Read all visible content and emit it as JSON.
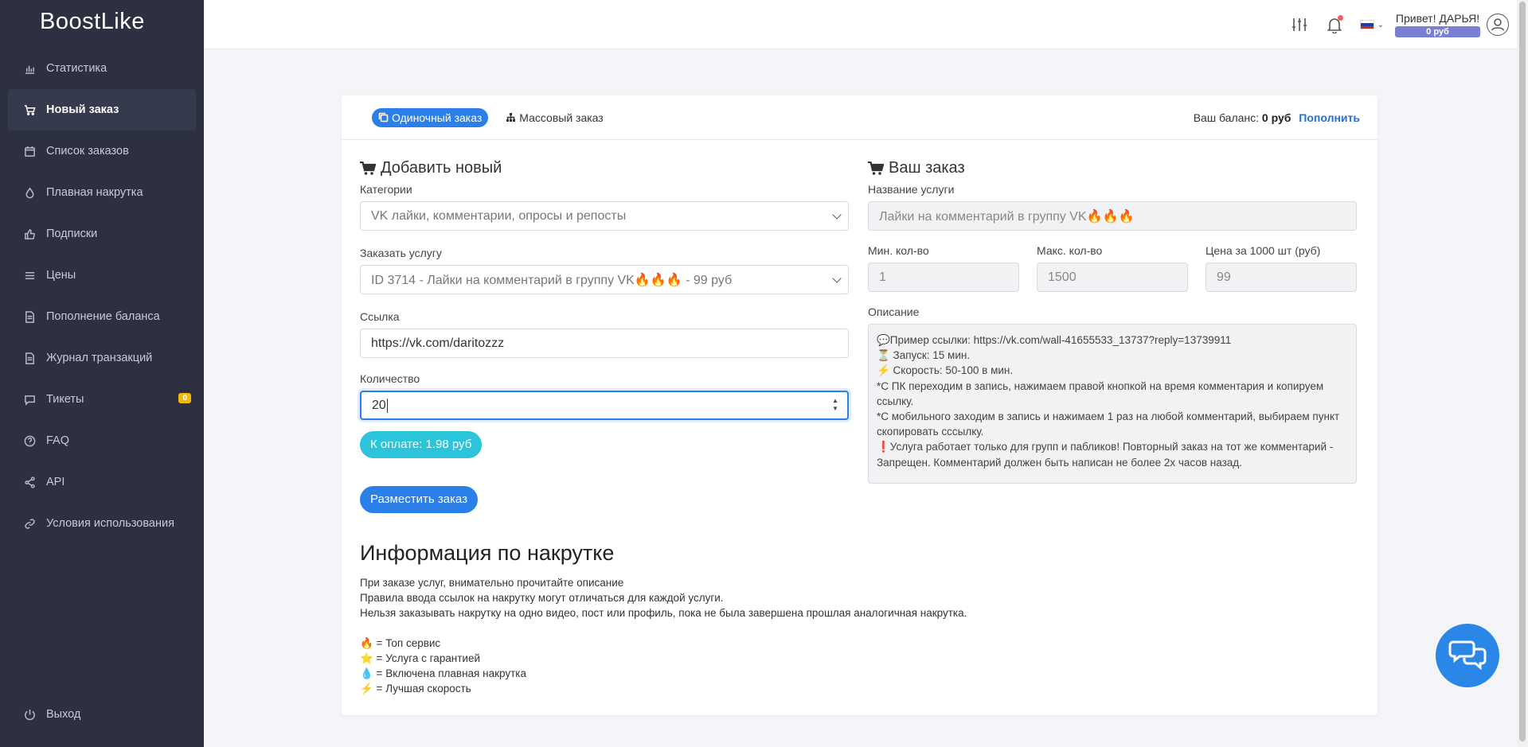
{
  "app": {
    "logo_text": "BoostLike"
  },
  "sidebar": {
    "items": [
      {
        "label": "Статистика",
        "icon": "bar-chart-icon"
      },
      {
        "label": "Новый заказ",
        "icon": "cart-icon",
        "active": true
      },
      {
        "label": "Список заказов",
        "icon": "calendar-icon"
      },
      {
        "label": "Плавная накрутка",
        "icon": "drop-icon"
      },
      {
        "label": "Подписки",
        "icon": "thumbs-up-icon"
      },
      {
        "label": "Цены",
        "icon": "list-icon"
      },
      {
        "label": "Пополнение баланса",
        "icon": "document-icon"
      },
      {
        "label": "Журнал транзакций",
        "icon": "document-icon"
      },
      {
        "label": "Тикеты",
        "icon": "chat-icon",
        "badge": "0"
      },
      {
        "label": "FAQ",
        "icon": "question-icon"
      },
      {
        "label": "API",
        "icon": "share-icon"
      },
      {
        "label": "Условия использования",
        "icon": "link-icon"
      }
    ],
    "logout_label": "Выход"
  },
  "topbar": {
    "greeting": "Привет! ДАРЬЯ!",
    "balance_badge": "0 руб"
  },
  "card": {
    "tabs": [
      {
        "label": "Одиночный заказ",
        "active": true
      },
      {
        "label": "Массовый заказ",
        "active": false
      }
    ],
    "balance_label": "Ваш баланс:",
    "balance_value": "0 руб",
    "topup_label": "Пополнить"
  },
  "form": {
    "title": "Добавить новый",
    "category_label": "Категории",
    "category_value": "VK лайки, комментарии, опросы и репосты",
    "service_label": "Заказать услугу",
    "service_value": "ID 3714 - Лайки на комментарий в группу VK🔥🔥🔥 - 99 руб",
    "link_label": "Ссылка",
    "link_value": "https://vk.com/daritozzz",
    "quantity_label": "Количество",
    "quantity_value": "20",
    "pay_button": "К оплате: 1.98 руб",
    "submit_button": "Разместить заказ"
  },
  "order": {
    "title": "Ваш заказ",
    "service_name_label": "Название услуги",
    "service_name_value": "Лайки на комментарий в группу VK🔥🔥🔥",
    "min_label": "Мин. кол-во",
    "min_value": "1",
    "max_label": "Макс. кол-во",
    "max_value": "1500",
    "price_label": "Цена за 1000 шт (руб)",
    "price_value": "99",
    "description_label": "Описание",
    "description_lines": [
      "💬Пример ссылки: https://vk.com/wall-41655533_13737?reply=13739911",
      "⏳ Запуск: 15 мин.",
      "⚡ Скорость: 50-100 в мин.",
      "*С ПК переходим в запись, нажимаем правой кнопкой на время комментария и копируем ссылку.",
      "*С мобильного заходим в запись и нажимаем 1 раз на любой комментарий, выбираем пункт скопировать сссылку.",
      "❗Услуга работает только для групп и пабликов! Повторный заказ на тот же комментарий - Запрещен. Комментарий должен быть написан не более 2х часов назад."
    ]
  },
  "info": {
    "title": "Информация по накрутке",
    "lines": [
      "При заказе услуг, внимательно прочитайте описание",
      "Правила ввода ссылок на накрутку могут отличаться для каждой услуги.",
      "Нельзя заказывать накрутку на одно видео, пост или профиль, пока не была завершена прошлая аналогичная накрутка."
    ],
    "legend": [
      "🔥 = Топ сервис",
      "⭐ = Услуга с гарантией",
      "💧 = Включена плавная накрутка",
      "⚡ = Лучшая скорость"
    ]
  },
  "colors": {
    "sidebar_bg": "#2c3040",
    "primary": "#2a7fe8",
    "pay": "#2bc4da",
    "badge": "#f0b90b",
    "balance_badge": "#7a7fd4"
  }
}
